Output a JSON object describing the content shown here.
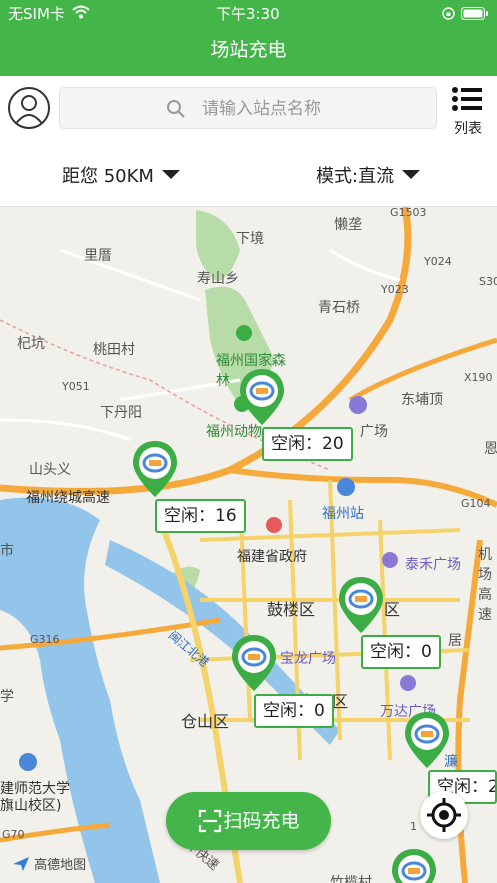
{
  "status_bar": {
    "carrier": "无SIM卡",
    "time": "下午3:30"
  },
  "nav": {
    "title": "场站充电"
  },
  "search": {
    "placeholder": "请输入站点名称"
  },
  "list_button": {
    "label": "列表"
  },
  "filters": {
    "distance": "距您 50KM",
    "mode": "模式:直流"
  },
  "map_labels": {
    "lanzhuo": "懒垄",
    "g1503": "G1503",
    "xiajing": "下境",
    "licuo": "里厝",
    "y024": "Y024",
    "shoushanxiang": "寿山乡",
    "qingshiqiao": "青石桥",
    "y023": "Y023",
    "s30": "S30",
    "jikeng": "杞坑",
    "taotiancun": "桃田村",
    "fuzhou_forest": "福州国家森林",
    "y051": "Y051",
    "y190": "X190",
    "dongpuding": "东埔顶",
    "xiadanyang": "下丹阳",
    "fuzhou_zoo": "福州动物",
    "guangchang": "广场",
    "shantouyi": "山头义",
    "ring_expressway": "福州绕城高速",
    "fuzhou_station": "福州站",
    "g104": "G104",
    "provincial_gov": "福建省政府",
    "taihe_plaza": "泰禾广场",
    "airport_expressway": "机场高速",
    "gulou": "鼓楼区",
    "gulou_qu": "区",
    "g316": "G316",
    "baolong_plaza": "宝龙广场",
    "minjiang_road": "闽江北港",
    "juju": "居",
    "taijiang": "台江区",
    "cangshan": "仓山区",
    "wanda_plaza": "万达广场",
    "normal_univ": "建师范大学",
    "qishan_campus": "旗山校区)",
    "g70": "G70",
    "expressway": "三环快速",
    "zhulou": "竹榄村",
    "xue": "学",
    "shi": "市",
    "en": "恩",
    "lian": "濂",
    "num_1": "1"
  },
  "stations": [
    {
      "label": "空闲：20"
    },
    {
      "label": "空闲：16"
    },
    {
      "label": "空闲：0"
    },
    {
      "label": "空闲：0"
    },
    {
      "label": "空闲：2"
    }
  ],
  "scan_button": {
    "label": "扫码充电"
  },
  "map_logo": {
    "label": "高德地图"
  },
  "colors": {
    "brand": "#44b549",
    "pin": "#3cad45",
    "road_major": "#f6a93b",
    "road_minor": "#f5d36a",
    "water": "#93c4ea",
    "green": "#b8dca8"
  }
}
